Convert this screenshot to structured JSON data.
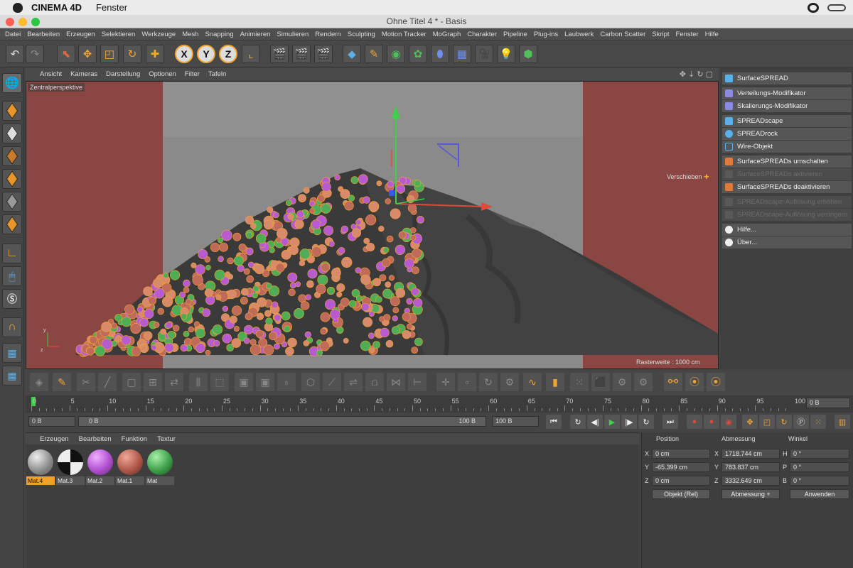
{
  "mac_menu": {
    "app_name": "CINEMA 4D",
    "window_menu": "Fenster"
  },
  "window": {
    "title": "Ohne Titel 4 * - Basis"
  },
  "menu": [
    "Datei",
    "Bearbeiten",
    "Erzeugen",
    "Selektieren",
    "Werkzeuge",
    "Mesh",
    "Snapping",
    "Animieren",
    "Simulieren",
    "Rendern",
    "Sculpting",
    "Motion Tracker",
    "MoGraph",
    "Charakter",
    "Pipeline",
    "Plug-ins",
    "Laubwerk",
    "Carbon Scatter",
    "Skript",
    "Fenster",
    "Hilfe"
  ],
  "toolbar": {
    "axis_x": "X",
    "axis_y": "Y",
    "axis_z": "Z"
  },
  "viewport": {
    "menu": [
      "Ansicht",
      "Kameras",
      "Darstellung",
      "Optionen",
      "Filter",
      "Tafeln"
    ],
    "camera_label": "Zentralperspektive",
    "move_label": "Verschieben",
    "grid_label": "Rasterweite : 1000 cm"
  },
  "plugin_menu": {
    "items": [
      {
        "label": "SurfaceSPREAD",
        "enabled": true
      },
      {
        "label": "Verteilungs-Modifikator",
        "enabled": true
      },
      {
        "label": "Skalierungs-Modifikator",
        "enabled": true
      },
      {
        "label": "SPREADscape",
        "enabled": true
      },
      {
        "label": "SPREADrock",
        "enabled": true
      },
      {
        "label": "Wire-Objekt",
        "enabled": true
      },
      {
        "label": "SurfaceSPREADs umschalten",
        "enabled": true
      },
      {
        "label": "SurfaceSPREADs aktivieren",
        "enabled": false
      },
      {
        "label": "SurfaceSPREADs deaktivieren",
        "enabled": true
      },
      {
        "label": "SPREADscape-Auflösung erhöhen",
        "enabled": false
      },
      {
        "label": "SPREADscape-Auflösung verringern",
        "enabled": false
      },
      {
        "label": "Hilfe...",
        "enabled": true
      },
      {
        "label": "Über...",
        "enabled": true
      }
    ]
  },
  "timeline": {
    "ticks": [
      "0",
      "5",
      "10",
      "15",
      "20",
      "25",
      "30",
      "35",
      "40",
      "45",
      "50",
      "55",
      "60",
      "65",
      "70",
      "75",
      "80",
      "85",
      "90",
      "95",
      "100"
    ],
    "current_frame": "0 B",
    "start": "0 B",
    "slider_start": "0 B",
    "slider_end": "100 B",
    "end": "100 B"
  },
  "materials": {
    "menu": [
      "Erzeugen",
      "Bearbeiten",
      "Funktion",
      "Textur"
    ],
    "items": [
      {
        "name": "Mat.4",
        "color": "#bdbdbd",
        "selected": true
      },
      {
        "name": "Mat.3",
        "color": "checker",
        "selected": false
      },
      {
        "name": "Mat.2",
        "color": "#c56ed8",
        "selected": false
      },
      {
        "name": "Mat.1",
        "color": "#c06a5a",
        "selected": false
      },
      {
        "name": "Mat",
        "color": "#4fae55",
        "selected": false
      }
    ]
  },
  "coordinates": {
    "headers": {
      "position": "Position",
      "size": "Abmessung",
      "rotation": "Winkel"
    },
    "rows": [
      {
        "pl": "X",
        "pv": "0 cm",
        "sl": "X",
        "sv": "1718.744 cm",
        "rl": "H",
        "rv": "0 °"
      },
      {
        "pl": "Y",
        "pv": "-65.399 cm",
        "sl": "Y",
        "sv": "783.837 cm",
        "rl": "P",
        "rv": "0 °"
      },
      {
        "pl": "Z",
        "pv": "0 cm",
        "sl": "Z",
        "sv": "3332.649 cm",
        "rl": "B",
        "rv": "0 °"
      }
    ],
    "mode_select": "Objekt (Rel)",
    "size_select": "Abmessung +",
    "apply": "Anwenden"
  },
  "colors": {
    "accent": "#f2a531",
    "viewport_bg": "#8e8e8e",
    "safe_frame": "#8a3a36"
  }
}
